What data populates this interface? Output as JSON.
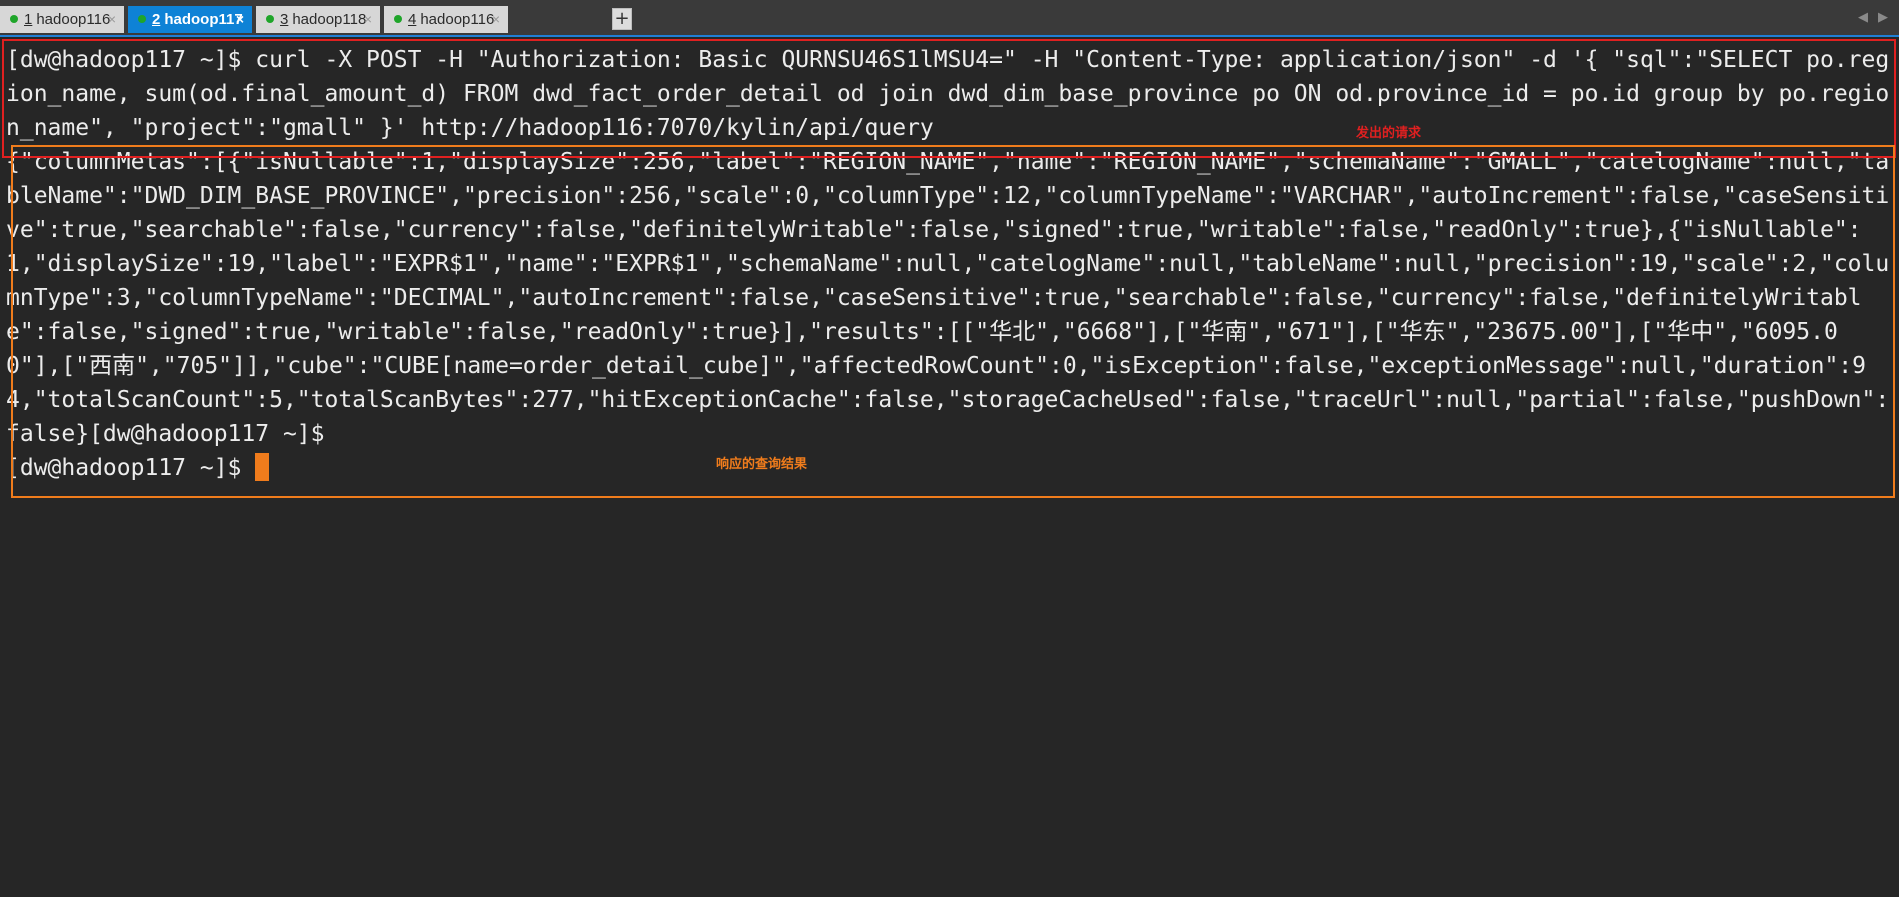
{
  "tabs": [
    {
      "num": "1",
      "label": "hadoop116",
      "close": "×"
    },
    {
      "num": "2",
      "label": "hadoop117",
      "close": "×"
    },
    {
      "num": "3",
      "label": "hadoop118",
      "close": "×"
    },
    {
      "num": "4",
      "label": "hadoop116",
      "close": "×"
    }
  ],
  "active_tab_index": 1,
  "add_tab_label": "+",
  "scroll_left": "◀",
  "scroll_right": "▶",
  "terminal": {
    "command_line": "[dw@hadoop117 ~]$ curl -X POST -H \"Authorization: Basic QURNSU46S1lMSU4=\" -H \"Content-Type: application/json\" -d '{ \"sql\":\"SELECT po.region_name, sum(od.final_amount_d) FROM dwd_fact_order_detail od join dwd_dim_base_province po ON od.province_id = po.id group by po.region_name\", \"project\":\"gmall\" }' http://hadoop116:7070/kylin/api/query",
    "response": "{\"columnMetas\":[{\"isNullable\":1,\"displaySize\":256,\"label\":\"REGION_NAME\",\"name\":\"REGION_NAME\",\"schemaName\":\"GMALL\",\"catelogName\":null,\"tableName\":\"DWD_DIM_BASE_PROVINCE\",\"precision\":256,\"scale\":0,\"columnType\":12,\"columnTypeName\":\"VARCHAR\",\"autoIncrement\":false,\"caseSensitive\":true,\"searchable\":false,\"currency\":false,\"definitelyWritable\":false,\"signed\":true,\"writable\":false,\"readOnly\":true},{\"isNullable\":1,\"displaySize\":19,\"label\":\"EXPR$1\",\"name\":\"EXPR$1\",\"schemaName\":null,\"catelogName\":null,\"tableName\":null,\"precision\":19,\"scale\":2,\"columnType\":3,\"columnTypeName\":\"DECIMAL\",\"autoIncrement\":false,\"caseSensitive\":true,\"searchable\":false,\"currency\":false,\"definitelyWritable\":false,\"signed\":true,\"writable\":false,\"readOnly\":true}],\"results\":[[\"华北\",\"6668\"],[\"华南\",\"671\"],[\"华东\",\"23675.00\"],[\"华中\",\"6095.00\"],[\"西南\",\"705\"]],\"cube\":\"CUBE[name=order_detail_cube]\",\"affectedRowCount\":0,\"isException\":false,\"exceptionMessage\":null,\"duration\":94,\"totalScanCount\":5,\"totalScanBytes\":277,\"hitExceptionCache\":false,\"storageCacheUsed\":false,\"traceUrl\":null,\"partial\":false,\"pushDown\":false}[dw@hadoop117 ~]$",
    "prompt": "[dw@hadoop117 ~]$ "
  },
  "annotations": {
    "request_label": "发出的请求",
    "response_label": "响应的查询结果",
    "request_color": "#e02020",
    "response_color": "#f07c1c"
  },
  "colors": {
    "terminal_bg": "#262626",
    "terminal_fg": "#ececec",
    "active_tab": "#0e82d6",
    "status_dot": "#1fa52a",
    "cursor": "#f07c1c"
  }
}
